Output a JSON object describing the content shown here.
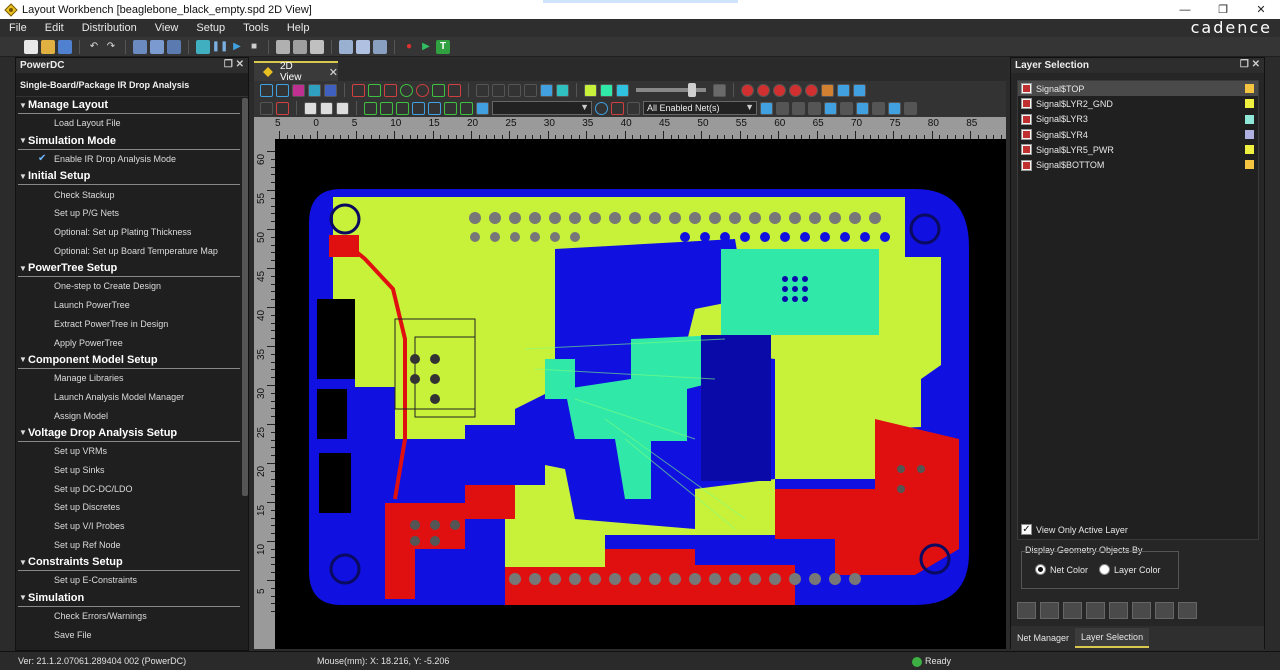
{
  "window": {
    "title": "Layout Workbench [beaglebone_black_empty.spd 2D View]",
    "controls": {
      "minimize": "—",
      "restore": "❐",
      "close": "✕"
    }
  },
  "menubar": {
    "items": [
      "File",
      "Edit",
      "Distribution",
      "View",
      "Setup",
      "Tools",
      "Help"
    ],
    "brand": "cadence"
  },
  "left_panel": {
    "title": "PowerDC",
    "subtitle": "Single-Board/Package IR Drop Analysis",
    "sections": [
      {
        "title": "Manage Layout",
        "items": [
          {
            "label": "Load Layout File"
          }
        ]
      },
      {
        "title": "Simulation Mode",
        "items": [
          {
            "label": "Enable IR Drop Analysis Mode",
            "checked": true
          }
        ]
      },
      {
        "title": "Initial Setup",
        "items": [
          {
            "label": "Check Stackup"
          },
          {
            "label": "Set up P/G Nets"
          },
          {
            "label": "Optional: Set up Plating Thickness"
          },
          {
            "label": "Optional: Set up Board Temperature Map"
          }
        ]
      },
      {
        "title": "PowerTree Setup",
        "items": [
          {
            "label": "One-step to Create Design"
          },
          {
            "label": "Launch PowerTree"
          },
          {
            "label": "Extract PowerTree in Design"
          },
          {
            "label": "Apply PowerTree"
          }
        ]
      },
      {
        "title": "Component Model Setup",
        "items": [
          {
            "label": "Manage Libraries"
          },
          {
            "label": "Launch Analysis Model Manager"
          },
          {
            "label": "Assign Model"
          }
        ]
      },
      {
        "title": "Voltage Drop Analysis Setup",
        "items": [
          {
            "label": "Set up VRMs"
          },
          {
            "label": "Set up Sinks"
          },
          {
            "label": "Set up DC-DC/LDO"
          },
          {
            "label": "Set up Discretes"
          },
          {
            "label": "Set up V/I Probes"
          },
          {
            "label": "Set up Ref Node"
          }
        ]
      },
      {
        "title": "Constraints Setup",
        "items": [
          {
            "label": "Set up E-Constraints"
          }
        ]
      },
      {
        "title": "Simulation",
        "items": [
          {
            "label": "Check Errors/Warnings"
          },
          {
            "label": "Save File"
          }
        ]
      }
    ]
  },
  "view_tab": {
    "label": "2D View",
    "close": "✕"
  },
  "view_toolbar": {
    "net_filter": "All Enabled Net(s)"
  },
  "ruler": {
    "top_labels": [
      "5",
      "0",
      "5",
      "10",
      "15",
      "20",
      "25",
      "30",
      "35",
      "40",
      "45",
      "50",
      "55",
      "60",
      "65",
      "70",
      "75",
      "80",
      "85"
    ],
    "left_labels": [
      "60",
      "55",
      "50",
      "45",
      "40",
      "35",
      "30",
      "25",
      "20",
      "15",
      "10",
      "5"
    ]
  },
  "layer_panel": {
    "title": "Layer Selection",
    "layers": [
      {
        "name": "Signal$TOP",
        "color": "#f5c542",
        "selected": true
      },
      {
        "name": "Signal$LYR2_GND",
        "color": "#f0f040"
      },
      {
        "name": "Signal$LYR3",
        "color": "#8fe8d8"
      },
      {
        "name": "Signal$LYR4",
        "color": "#b0b0e0"
      },
      {
        "name": "Signal$LYR5_PWR",
        "color": "#f0f040"
      },
      {
        "name": "Signal$BOTTOM",
        "color": "#f5c542"
      }
    ],
    "view_only_active": "View Only Active Layer",
    "display_group": "Display Geometry Objects By",
    "net_color": "Net Color",
    "layer_color": "Layer Color",
    "tabs": [
      "Net Manager",
      "Layer Selection"
    ]
  },
  "statusbar": {
    "version": "Ver: 21.1.2.07061.289404 002 (PowerDC)",
    "mouse": "Mouse(mm): X: 18.216, Y: -5.206",
    "status": "Ready"
  },
  "colors": {
    "board_yellow": "#c8f23a",
    "board_blue": "#1010e0",
    "board_red": "#e01010",
    "board_teal": "#30e8a8",
    "accent_tab": "#d8c850"
  }
}
